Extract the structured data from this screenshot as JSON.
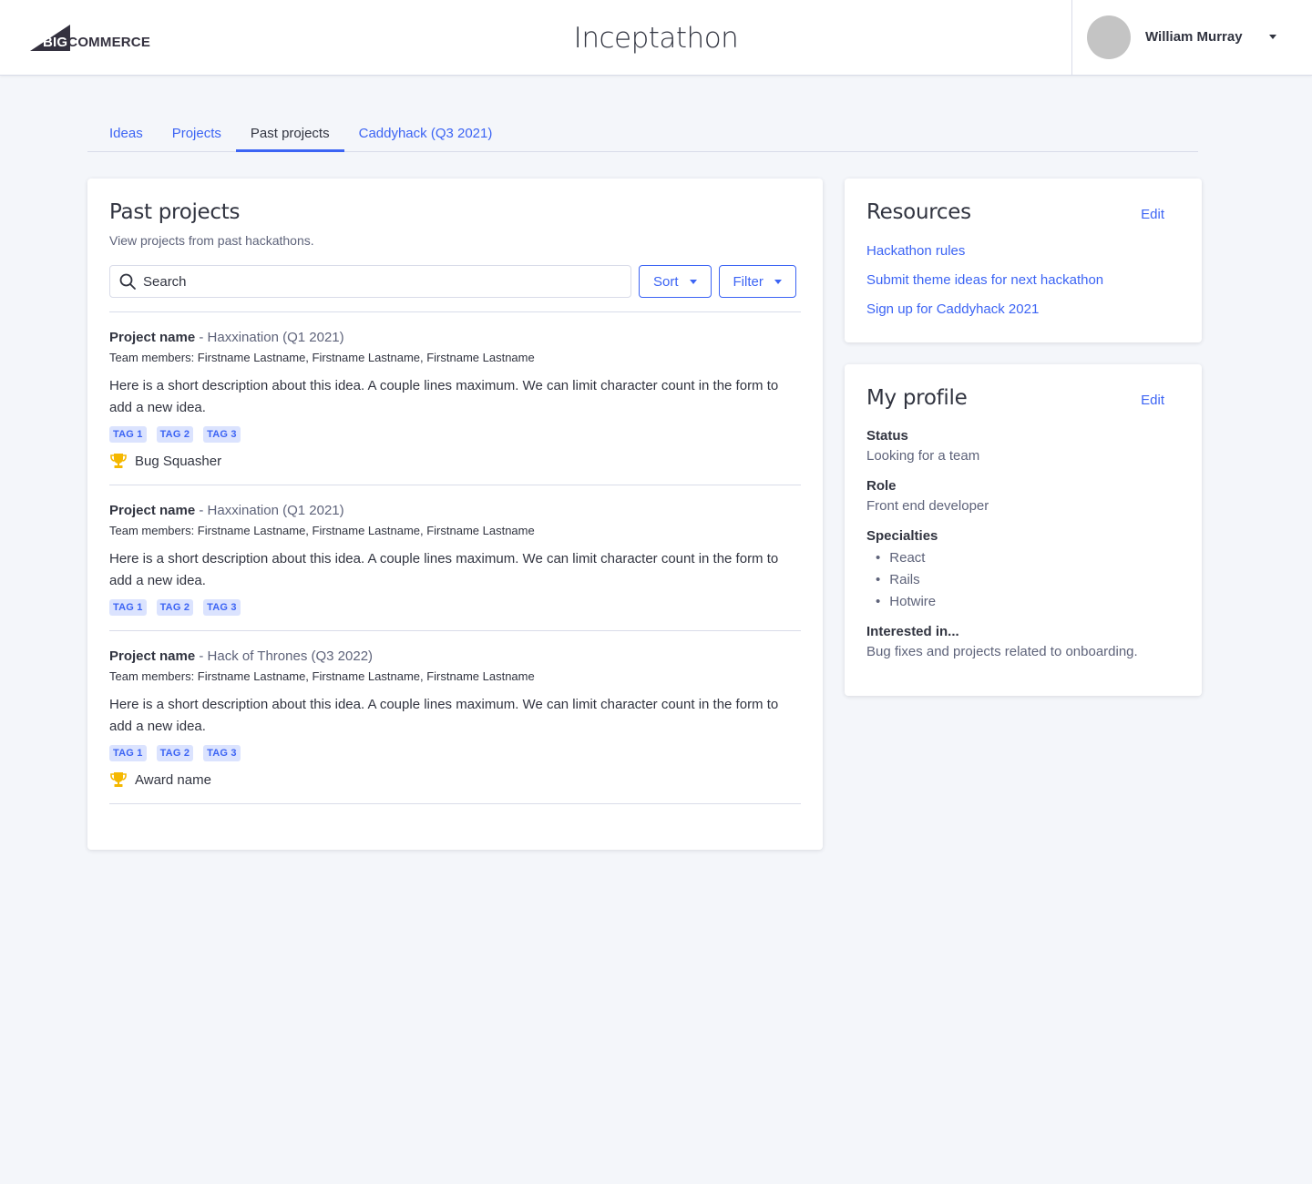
{
  "header": {
    "logo_big": "BIG",
    "logo_commerce": "COMMERCE",
    "app_title": "Inceptathon",
    "user_name": "William Murray"
  },
  "tabs": [
    {
      "label": "Ideas",
      "active": false
    },
    {
      "label": "Projects",
      "active": false
    },
    {
      "label": "Past projects",
      "active": true
    },
    {
      "label": "Caddyhack (Q3 2021)",
      "active": false
    }
  ],
  "main": {
    "title": "Past projects",
    "subtitle": "View projects from past hackathons.",
    "search_placeholder": "Search",
    "sort_label": "Sort",
    "filter_label": "Filter",
    "projects": [
      {
        "name": "Project name",
        "event": "- Haxxination (Q1 2021)",
        "team": "Team members: Firstname Lastname, Firstname Lastname, Firstname Lastname",
        "description": "Here is a short description about this idea. A couple lines maximum. We can limit character count in the form to add a new idea.",
        "tags": [
          "TAG 1",
          "TAG 2",
          "TAG 3"
        ],
        "award": "Bug Squasher"
      },
      {
        "name": "Project name",
        "event": "- Haxxination (Q1 2021)",
        "team": "Team members: Firstname Lastname, Firstname Lastname, Firstname Lastname",
        "description": "Here is a short description about this idea. A couple lines maximum. We can limit character count in the form to add a new idea.",
        "tags": [
          "TAG 1",
          "TAG 2",
          "TAG 3"
        ],
        "award": ""
      },
      {
        "name": "Project name",
        "event": "- Hack of Thrones (Q3 2022)",
        "team": "Team members: Firstname Lastname, Firstname Lastname, Firstname Lastname",
        "description": "Here is a short description about this idea. A couple lines maximum. We can limit character count in the form to add a new idea.",
        "tags": [
          "TAG 1",
          "TAG 2",
          "TAG 3"
        ],
        "award": "Award name"
      }
    ]
  },
  "resources": {
    "title": "Resources",
    "edit_label": "Edit",
    "links": [
      "Hackathon rules",
      "Submit theme ideas for next hackathon",
      "Sign up for Caddyhack 2021"
    ]
  },
  "profile": {
    "title": "My profile",
    "edit_label": "Edit",
    "status_label": "Status",
    "status_value": "Looking for a team",
    "role_label": "Role",
    "role_value": "Front end developer",
    "specialties_label": "Specialties",
    "specialties": [
      "React",
      "Rails",
      "Hotwire"
    ],
    "interests_label": "Interested in...",
    "interests_value": "Bug fixes and projects related to onboarding."
  },
  "colors": {
    "accent": "#3c64f4",
    "award_gold": "#f5b800",
    "background": "#f4f6fa"
  },
  "icons": {
    "logo": "bigcommerce-logo",
    "search": "search-icon",
    "award": "trophy-icon",
    "dropdown": "caret-down-icon"
  }
}
